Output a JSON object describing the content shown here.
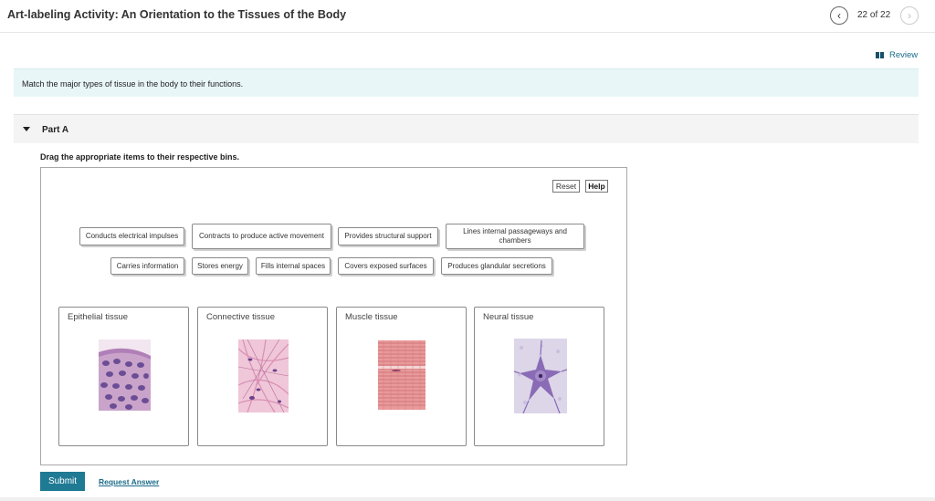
{
  "header": {
    "title": "Art-labeling Activity: An Orientation to the Tissues of the Body",
    "page_count": "22 of 22",
    "prev_icon": "chevron-left-icon",
    "next_icon": "chevron-right-icon"
  },
  "review": {
    "label": "Review",
    "icon": "review-icon"
  },
  "instruction": "Match the major types of tissue in the body to their functions.",
  "part": {
    "label": "Part A",
    "icon": "caret-down-icon"
  },
  "drag_instruction": "Drag the appropriate items to their respective bins.",
  "controls": {
    "reset": "Reset",
    "help": "Help"
  },
  "labels": [
    "Conducts electrical impulses",
    "Contracts to produce active movement",
    "Provides structural support",
    "Lines internal passageways and chambers",
    "Carries information",
    "Stores energy",
    "Fills internal spaces",
    "Covers exposed surfaces",
    "Produces glandular secretions"
  ],
  "bins": [
    {
      "label": "Epithelial tissue"
    },
    {
      "label": "Connective tissue"
    },
    {
      "label": "Muscle tissue"
    },
    {
      "label": "Neural tissue"
    }
  ],
  "footer": {
    "submit": "Submit",
    "request_answer": "Request Answer"
  },
  "colors": {
    "accent": "#1f7a94",
    "instruction_bg": "#e8f6f8",
    "link": "#1a6b8a"
  }
}
